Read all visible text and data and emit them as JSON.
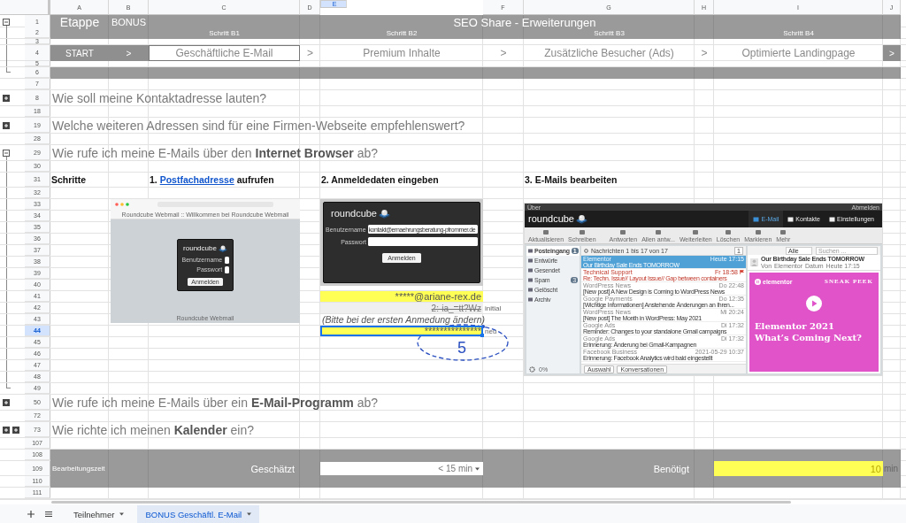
{
  "column_headers": [
    {
      "label": "A",
      "selected": false
    },
    {
      "label": "B",
      "selected": false
    },
    {
      "label": "C",
      "selected": false
    },
    {
      "label": "D",
      "selected": false
    },
    {
      "label": "E",
      "selected": true
    },
    {
      "label": "F",
      "selected": false
    },
    {
      "label": "G",
      "selected": false
    },
    {
      "label": "H",
      "selected": false
    },
    {
      "label": "I",
      "selected": false
    },
    {
      "label": "J",
      "selected": false
    }
  ],
  "rows": [
    {
      "number": "1",
      "kind": "title",
      "selected": false,
      "outline": {
        "kind": "collapse"
      },
      "cells": [
        "Etappe",
        "BONUS"
      ],
      "title": "SEO Share - Erweiterungen"
    },
    {
      "number": "2",
      "kind": "subtitle",
      "selected": false,
      "outline": {
        "kind": "line"
      },
      "labels": [
        "Schritt B1",
        "Schritt B2",
        "Schritt B3",
        "Schritt B4"
      ]
    },
    {
      "number": "3",
      "kind": "gap",
      "selected": false,
      "outline": {
        "kind": "line"
      }
    },
    {
      "number": "4",
      "kind": "steps",
      "selected": false,
      "outline": {
        "kind": "line"
      },
      "cells": [
        {
          "label": "START",
          "kind": "dark"
        },
        {
          "label": ">",
          "kind": "dark"
        },
        {
          "label": "Geschäftliche E-Mail",
          "kind": "current"
        },
        {
          "label": ">",
          "kind": "plain"
        },
        {
          "label": "Premium Inhalte",
          "kind": "plain"
        },
        {
          "label": ">",
          "kind": "plain"
        },
        {
          "label": "Zusätzliche Besucher (Ads)",
          "kind": "plain"
        },
        {
          "label": ">",
          "kind": "plain"
        },
        {
          "label": "Optimierte Landingpage",
          "kind": "plain"
        },
        {
          "label": ">",
          "kind": "dark"
        }
      ]
    },
    {
      "number": "5",
      "kind": "gap",
      "selected": false,
      "outline": {
        "kind": "line"
      }
    },
    {
      "number": "6",
      "kind": "band",
      "selected": false,
      "outline": {
        "kind": "line-end"
      }
    },
    {
      "number": "7",
      "kind": "blank",
      "selected": false
    },
    {
      "number": "8",
      "kind": "question",
      "selected": false,
      "outline": {
        "kind": "expand"
      },
      "text": "Wie soll meine Kontaktadresse lauten?"
    },
    {
      "number": "18",
      "kind": "blank",
      "selected": false
    },
    {
      "number": "19",
      "kind": "question",
      "selected": false,
      "outline": {
        "kind": "expand"
      },
      "text": "Welche weiteren Adressen sind für eine Firmen-Webseite empfehlenswert?"
    },
    {
      "number": "28",
      "kind": "blank",
      "selected": false
    },
    {
      "number": "29",
      "kind": "question",
      "selected": false,
      "outline": {
        "kind": "collapse"
      },
      "text": "Wie rufe ich meine E-Mails über den **Internet Browser** ab?"
    },
    {
      "number": "30",
      "kind": "blank",
      "selected": false,
      "outline": {
        "kind": "line"
      }
    },
    {
      "number": "31",
      "kind": "labels",
      "selected": false,
      "outline": {
        "kind": "line"
      },
      "heading": "Schritte",
      "steps": [
        {
          "before": "1.",
          "link": "Postfachadresse",
          "after": "aufrufen"
        },
        {
          "text": "2. Anmeldedaten eingeben"
        },
        {
          "text": "3. E-Mails bearbeiten"
        }
      ]
    },
    {
      "number": "32",
      "kind": "blank",
      "selected": false,
      "outline": {
        "kind": "line"
      }
    },
    {
      "number": "33",
      "kind": "blank",
      "selected": false,
      "outline": {
        "kind": "line"
      }
    },
    {
      "number": "34",
      "kind": "blank",
      "selected": false,
      "outline": {
        "kind": "line"
      }
    },
    {
      "number": "35",
      "kind": "blank",
      "selected": false,
      "outline": {
        "kind": "line"
      }
    },
    {
      "number": "36",
      "kind": "blank",
      "selected": false,
      "outline": {
        "kind": "line"
      }
    },
    {
      "number": "37",
      "kind": "blank",
      "selected": false,
      "outline": {
        "kind": "line"
      }
    },
    {
      "number": "38",
      "kind": "blank",
      "selected": false,
      "outline": {
        "kind": "line"
      }
    },
    {
      "number": "39",
      "kind": "blank",
      "selected": false,
      "outline": {
        "kind": "line"
      }
    },
    {
      "number": "40",
      "kind": "blank",
      "selected": false,
      "outline": {
        "kind": "line"
      }
    },
    {
      "number": "41",
      "kind": "email",
      "selected": false,
      "outline": {
        "kind": "line"
      },
      "value": "*****@ariane-rex.de"
    },
    {
      "number": "42",
      "kind": "old-password",
      "selected": false,
      "outline": {
        "kind": "line"
      },
      "value": "2:-ia_=tt?Wz",
      "note": "initial"
    },
    {
      "number": "43",
      "kind": "hint",
      "selected": false,
      "outline": {
        "kind": "line"
      },
      "value": "(Bitte bei der ersten Anmedung ändern)"
    },
    {
      "number": "44",
      "kind": "new-password",
      "selected": true,
      "outline": {
        "kind": "line"
      },
      "value": "***************",
      "note": "neu"
    },
    {
      "number": "45",
      "kind": "blank",
      "selected": false,
      "outline": {
        "kind": "line"
      }
    },
    {
      "number": "46",
      "kind": "blank",
      "selected": false,
      "outline": {
        "kind": "line"
      }
    },
    {
      "number": "47",
      "kind": "blank",
      "selected": false,
      "outline": {
        "kind": "line"
      }
    },
    {
      "number": "48",
      "kind": "blank",
      "selected": false,
      "outline": {
        "kind": "line"
      }
    },
    {
      "number": "49",
      "kind": "blank",
      "selected": false,
      "outline": {
        "kind": "line-end"
      }
    },
    {
      "number": "50",
      "kind": "question",
      "selected": false,
      "outline": {
        "kind": "expand"
      },
      "text": "Wie rufe ich meine E-Mails über ein **E-Mail-Programm** ab?"
    },
    {
      "number": "72",
      "kind": "blank",
      "selected": false
    },
    {
      "number": "73",
      "kind": "question",
      "selected": false,
      "outline": {
        "kind": "expand-expand"
      },
      "text": "Wie richte ich meinen **Kalender** ein?"
    },
    {
      "number": "107",
      "kind": "blank",
      "selected": false
    },
    {
      "number": "108",
      "kind": "band",
      "selected": false
    },
    {
      "number": "109",
      "kind": "time",
      "selected": false,
      "label": "Bearbeitungszeit",
      "estimate_label": "Geschätzt",
      "estimate": "< 15 min",
      "actual_label": "Benötigt",
      "actual": "10",
      "unit": "min"
    },
    {
      "number": "110",
      "kind": "band",
      "selected": false
    },
    {
      "number": "111",
      "kind": "blank",
      "selected": false
    }
  ],
  "annotation": {
    "label": "5"
  },
  "screenshots": [
    {
      "kind": "browser-login",
      "tab_title": "Roundcube Webmail :: Willkommen bei Roundcube Webmail",
      "logo": "roundcube",
      "user_label": "Benutzername",
      "password_label": "Passwort",
      "button": "Anmelden",
      "footer": "Roundcube Webmail"
    },
    {
      "kind": "login",
      "logo": "roundcube",
      "user_label": "Benutzername",
      "user_value": "kontakt@ernaehrungsberatung-pfrommer.de",
      "password_label": "Passwort",
      "button": "Anmelden"
    },
    {
      "kind": "mail",
      "topbar": "Über",
      "logout": "Abmelden",
      "logo": "roundcube",
      "nav": [
        {
          "label": "E-Mail",
          "selected": true
        },
        {
          "label": "Kontakte",
          "selected": false
        },
        {
          "label": "Einstellungen",
          "selected": false
        }
      ],
      "toolbar": [
        "Aktualisieren",
        "Schreiben",
        "Antworten",
        "Allen antw...",
        "Weiterleiten",
        "Löschen",
        "Markieren",
        "Mehr"
      ],
      "folders": [
        {
          "label": "Posteingang",
          "count": "1",
          "selected": true
        },
        {
          "label": "Entwürfe",
          "selected": false
        },
        {
          "label": "Gesendet",
          "selected": false
        },
        {
          "label": "Spam",
          "count": "3",
          "selected": false
        },
        {
          "label": "Gelöscht",
          "selected": false
        },
        {
          "label": "Archiv",
          "selected": false
        }
      ],
      "quota": "0%",
      "list_title": "Nachrichten 1 bis 17 von 17",
      "page": "1",
      "messages": [
        {
          "sender": "Elementor",
          "time": "Heute 17:15",
          "subject": "Our Birthday Sale Ends TOMORROW",
          "selected": true,
          "flagged": false
        },
        {
          "sender": "Technical Support",
          "time": "Fr 18:58",
          "subject": "Re: Techn. Issue// Layout Issue// Gap between containers",
          "selected": false,
          "flagged": true
        },
        {
          "sender": "WordPress News",
          "time": "Do 22:48",
          "subject": "[New post] A New Design is Coming to WordPress News",
          "selected": false,
          "flagged": false
        },
        {
          "sender": "Google Payments",
          "time": "Do 12:35",
          "subject": "[Wichtige Informationen] Anstehende Änderungen an Ihren...",
          "selected": false,
          "flagged": false
        },
        {
          "sender": "WordPress News",
          "time": "Mi 20:24",
          "subject": "[New post] The Month in WordPress: May 2021",
          "selected": false,
          "flagged": false
        },
        {
          "sender": "Google Ads",
          "time": "Di 17:32",
          "subject": "Reminder: Changes to your standalone Gmail campaigns",
          "selected": false,
          "flagged": false
        },
        {
          "sender": "Google Ads",
          "time": "Di 17:32",
          "subject": "Erinnerung: Änderung bei Gmail-Kampagnen",
          "selected": false,
          "flagged": false
        },
        {
          "sender": "Facebook Business",
          "time": "2021-05-29 10:37",
          "subject": "Erinnerung: Facebook Analytics wird bald eingestellt",
          "selected": false,
          "flagged": false
        }
      ],
      "list_footer": [
        "Auswahl",
        "Konversationen"
      ],
      "filter": "Alle",
      "search_placeholder": "Suchen ...",
      "preview": {
        "subject": "Our Birthday Sale Ends TOMORROW",
        "from_label": "Von",
        "from": "Elementor",
        "date_label": "Datum",
        "date": "Heute 17:15",
        "brand": "elementor",
        "tag": "SNEAK PEEK",
        "headline": [
          "Elementor 2021",
          "What’s Coming Next?"
        ]
      }
    }
  ],
  "sheet_tabs": [
    {
      "label": "Teilnehmer",
      "selected": false
    },
    {
      "label": "BONUS Geschäftl. E-Mail",
      "selected": true
    }
  ]
}
